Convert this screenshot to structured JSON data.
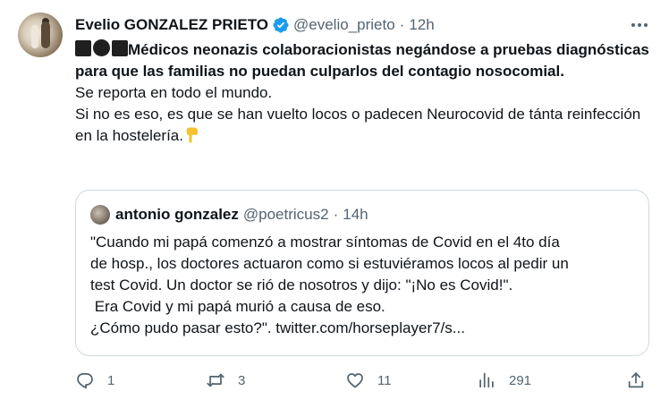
{
  "author": {
    "name": "Evelio GONZALEZ PRIETO",
    "handle": "@evelio_prieto",
    "separator": "·",
    "time": "12h",
    "verified": true
  },
  "tweet": {
    "lead_text": "Médicos neonazis colaboracionistas negándose a pruebas diagnósticas para que las familias no puedan culparlos del contagio nosocomial.",
    "line2": "Se reporta en todo el mundo.",
    "line3": "Si no es eso, es que se han vuelto locos o padecen Neurocovid de tánta reinfección en la hostelería.",
    "emoji": "backhand-index-pointing-down"
  },
  "quoted": {
    "name": "antonio gonzalez",
    "handle": "@poetricus2",
    "separator": "·",
    "time": "14h",
    "lines": [
      "\"Cuando mi papá comenzó a mostrar síntomas de Covid en el 4to día",
      "de hosp., los doctores actuaron como si estuviéramos locos al pedir un",
      "test Covid. Un doctor se rió de nosotros y dijo: \"¡No es Covid!\".",
      " Era Covid y mi papá murió a causa de eso.",
      "¿Cómo pudo pasar esto?\". twitter.com/horseplayer7/s..."
    ]
  },
  "actions": {
    "reply": {
      "icon": "reply-icon",
      "count": "1"
    },
    "retweet": {
      "icon": "retweet-icon",
      "count": "3"
    },
    "like": {
      "icon": "heart-icon",
      "count": "11"
    },
    "views": {
      "icon": "views-icon",
      "count": "291"
    },
    "share": {
      "icon": "share-icon"
    }
  },
  "colors": {
    "text": "#0f1419",
    "secondary": "#536471",
    "verified": "#1d9bf0",
    "border": "#cfd9de"
  }
}
